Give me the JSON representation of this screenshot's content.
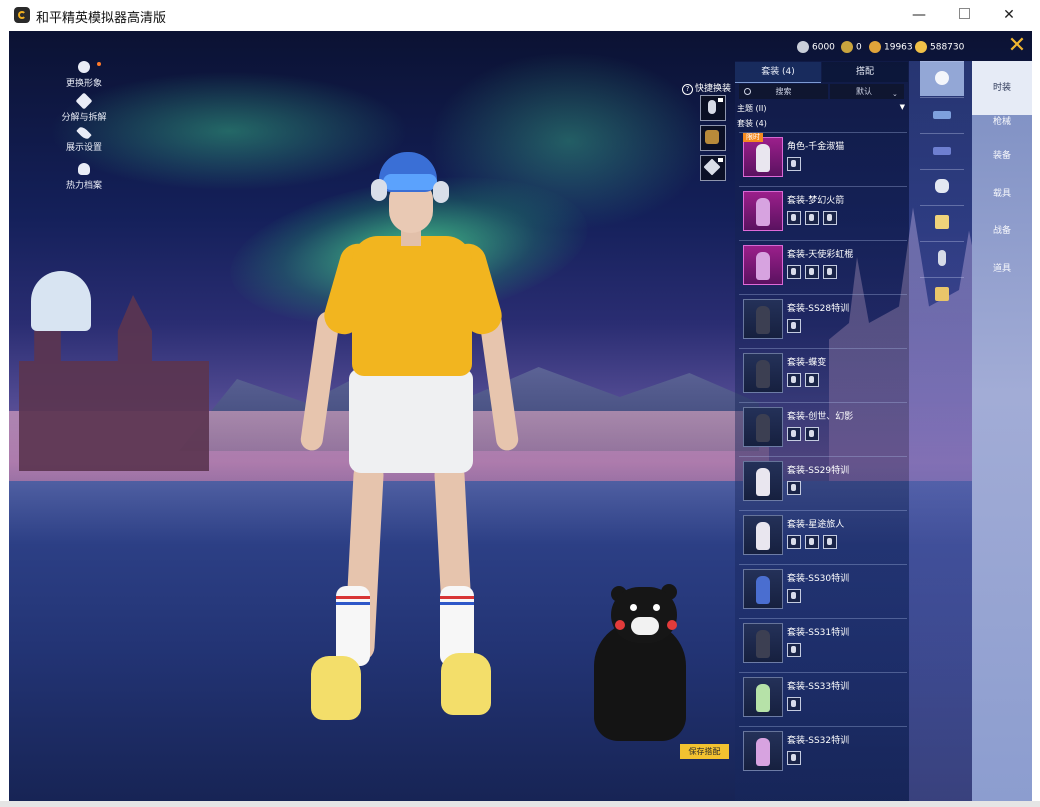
{
  "window": {
    "title": "和平精英模拟器高清版",
    "minimize": "—",
    "maximize": "",
    "close": "✕"
  },
  "left_menu": [
    {
      "label": "更换形象",
      "icon": "user-icon"
    },
    {
      "label": "分解与拆解",
      "icon": "puzzle-icon"
    },
    {
      "label": "展示设置",
      "icon": "eye-icon"
    },
    {
      "label": "热力档案",
      "icon": "fire-icon"
    }
  ],
  "currencies": [
    {
      "icon": "silver-coin-icon",
      "value": "6000",
      "color": "#c9ced9"
    },
    {
      "icon": "token-icon",
      "value": "0",
      "color": "#c9a43e"
    },
    {
      "icon": "gold-coupon-icon",
      "value": "19963",
      "color": "#e0a43a"
    },
    {
      "icon": "gold-coin-icon",
      "value": "588730",
      "color": "#f0c048"
    }
  ],
  "quick_change": {
    "label": "快捷换装",
    "help": "?"
  },
  "outfit_panel": {
    "tabs": [
      "套装 (4)",
      "搭配"
    ],
    "search_placeholder": "搜索",
    "sort_label": "默认",
    "theme_label": "主题 (II)",
    "suit_header": "套装 (4)",
    "items": [
      {
        "name": "角色-千金淑猫",
        "badge": "限时",
        "subs": 1
      },
      {
        "name": "套装-梦幻火箭",
        "badge": "",
        "subs": 3
      },
      {
        "name": "套装-天使彩虹棍",
        "badge": "",
        "subs": 3
      },
      {
        "name": "套装-SS28特训",
        "badge": "",
        "subs": 1
      },
      {
        "name": "套装-蝶变",
        "badge": "",
        "subs": 2
      },
      {
        "name": "套装-创世、幻影",
        "badge": "",
        "subs": 2
      },
      {
        "name": "套装-SS29特训",
        "badge": "",
        "subs": 1
      },
      {
        "name": "套装-星途旅人",
        "badge": "",
        "subs": 3
      },
      {
        "name": "套装-SS30特训",
        "badge": "",
        "subs": 1
      },
      {
        "name": "套装-SS31特训",
        "badge": "",
        "subs": 1
      },
      {
        "name": "套装-SS33特训",
        "badge": "",
        "subs": 1
      },
      {
        "name": "套装-SS32特训",
        "badge": "",
        "subs": 1
      }
    ],
    "save_button": "保存搭配"
  },
  "categories": [
    {
      "label": "时装",
      "active": true
    },
    {
      "label": "枪械",
      "active": false
    },
    {
      "label": "装备",
      "active": false
    },
    {
      "label": "载具",
      "active": false
    },
    {
      "label": "战备",
      "active": false
    },
    {
      "label": "道具",
      "active": false
    }
  ],
  "close_panel": "✕",
  "colors": {
    "accent_gold": "#f0b52f",
    "save_button": "#f2c230",
    "rare_frame": "#9b1f8b",
    "new_badge": "#f58a1f"
  }
}
